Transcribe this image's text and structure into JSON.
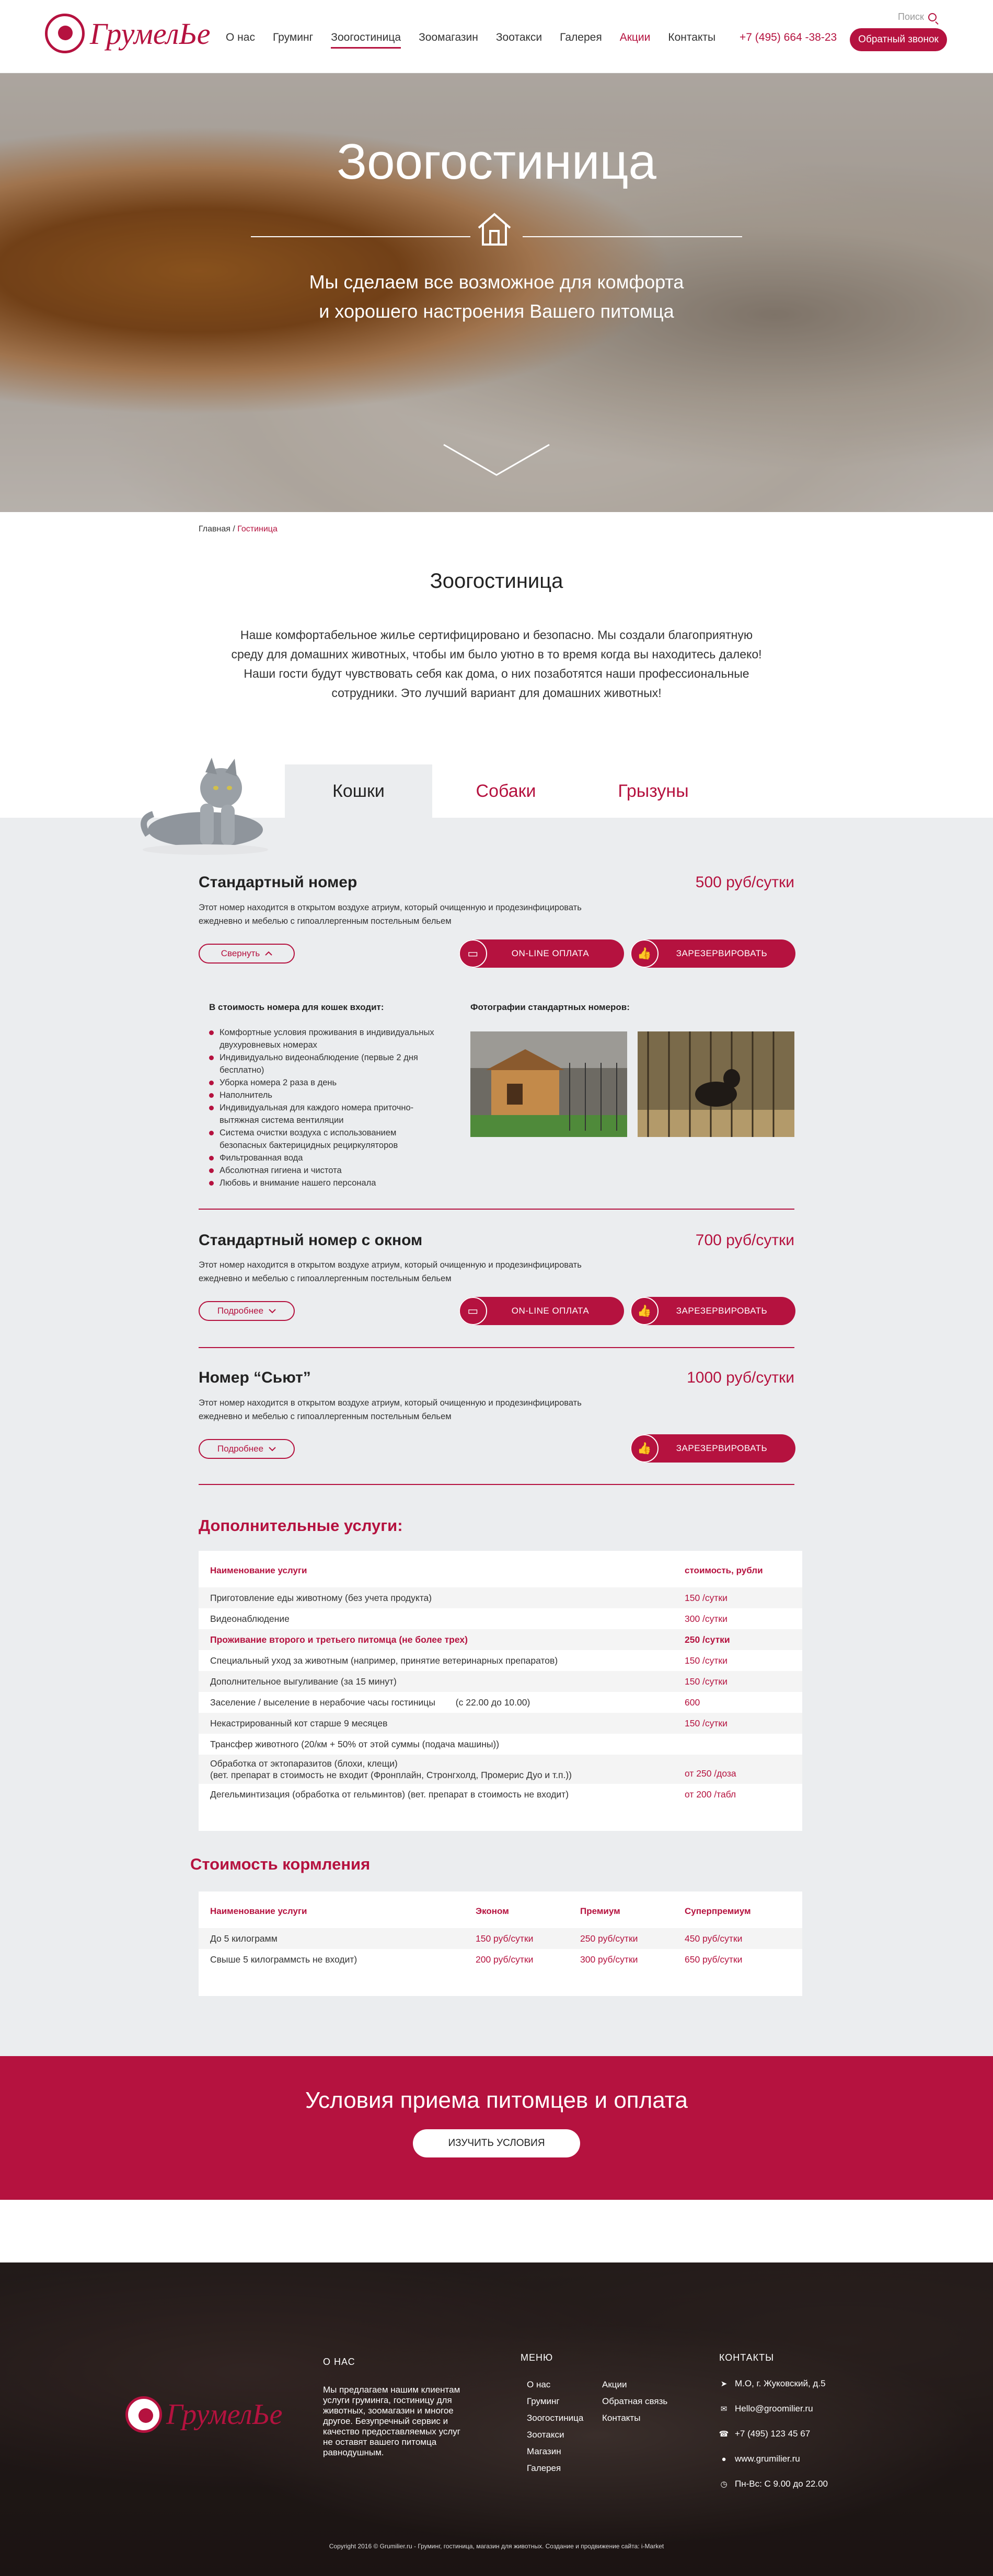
{
  "header": {
    "logo_text": "ГрумелЬе",
    "nav": [
      "О нас",
      "Груминг",
      "Зоогостиница",
      "Зоомагазин",
      "Зоотакси",
      "Галерея",
      "Акции",
      "Контакты"
    ],
    "phone": "+7 (495) 664 -38-23",
    "search_label": "Поиск",
    "callback_label": "Обратный звонок"
  },
  "hero": {
    "title": "Зоогостиница",
    "subtitle_line1": "Мы сделаем все возможное для комфорта",
    "subtitle_line2": "и хорошего настроения Вашего питомца"
  },
  "breadcrumb": {
    "home": "Главная",
    "sep": " / ",
    "current": "Гостиница"
  },
  "page_title": "Зоогостиница",
  "intro": "Наше комфортабельное жилье сертифицировано и безопасно. Мы создали благоприятную среду для домашних животных, чтобы им было уютно в то время когда вы находитесь далеко! Наши гости будут чувствовать себя как дома, о них позаботятся наши профессиональные сотрудники. Это лучший вариант для домашних животных!",
  "tabs": [
    "Кошки",
    "Собаки",
    "Грызуны"
  ],
  "rooms": [
    {
      "title": "Стандартный номер",
      "price": "500 руб/сутки",
      "desc": "Этот номер находится в открытом воздухе атриум, который очищенную и продезинфицировать ежедневно и мебелью с гипоаллергенным постельным бельем",
      "toggle": "Свернуть",
      "pay": "ON-LINE ОПЛАТА",
      "book": "ЗАРЕЗЕРВИРОВАТЬ"
    },
    {
      "title": "Стандартный номер с окном",
      "price": "700 руб/сутки",
      "desc": "Этот номер находится в открытом воздухе атриум, который очищенную и продезинфицировать ежедневно и мебелью с гипоаллергенным постельным бельем",
      "toggle": "Подробнее",
      "pay": "ON-LINE ОПЛАТА",
      "book": "ЗАРЕЗЕРВИРОВАТЬ"
    },
    {
      "title": "Номер “Сьют”",
      "price": "1000 руб/сутки",
      "desc": "Этот номер находится в открытом воздухе атриум, который очищенную и продезинфицировать ежедневно и мебелью с гипоаллергенным постельным бельем",
      "toggle": "Подробнее",
      "book": "ЗАРЕЗЕРВИРОВАТЬ"
    }
  ],
  "included": {
    "title": "В стоимость номера для кошек входит:",
    "items": [
      "Комфортные условия проживания в индивидуальных двухуровневых номерах",
      "Индивидуально видеонаблюдение (первые 2 дня бесплатно)",
      "Уборка номера 2 раза в день",
      "Наполнитель",
      "Индивидуальная для каждого номера приточно-вытяжная система вентиляции",
      "Система очистки воздуха с использованием безопасных бактерицидных рециркуляторов",
      "Фильтрованная вода",
      "Абсолютная гигиена и чистота",
      "Любовь и внимание нашего персонала"
    ],
    "photos_title": "Фотографии стандартных номеров:"
  },
  "extra": {
    "title": "Дополнительные услуги:",
    "head": {
      "name": "Наименование услуги",
      "price": "стоимость, рубли"
    },
    "rows": [
      {
        "name": "Приготовление еды животному (без учета продукта)",
        "price": "150 /сутки"
      },
      {
        "name": "Видеонаблюдение",
        "price": "300 /сутки"
      },
      {
        "name": "Проживание второго и третьего питомца (не более трех)",
        "price": "250 /сутки"
      },
      {
        "name": "Специальный уход за животным (например, принятие ветеринарных препаратов)",
        "price": "150 /сутки"
      },
      {
        "name": "Дополнительное выгуливание (за 15 минут)",
        "price": "150 /сутки"
      },
      {
        "name": "Заселение / выселение в нерабочие часы гостиницы        (с 22.00 до 10.00)",
        "price": "600"
      },
      {
        "name": "Некастрированный кот старше 9 месяцев",
        "price": "150 /сутки"
      },
      {
        "name": "Трансфер животного (20/км + 50% от этой суммы (подача машины))",
        "price": ""
      },
      {
        "name": "Обработка от эктопаразитов (блохи, клещи)",
        "name2": "(вет. препарат в стоимость не входит (Фронплайн, Стронгхолд, Промерис Дуо и т.п.))",
        "price": "от 250 /доза"
      },
      {
        "name": "Дегельминтизация (обработка от гельминтов) (вет. препарат в стоимость не входит)",
        "price": "от 200 /табл"
      }
    ]
  },
  "feeding": {
    "title": "Стоимость кормления",
    "head": [
      "Наименование услуги",
      "Эконом",
      "Премиум",
      "Суперпремиум"
    ],
    "rows": [
      [
        "До 5 килограмм",
        "150 руб/сутки",
        "250 руб/сутки",
        "450 руб/сутки"
      ],
      [
        "Свыше 5 килограммсть не входит)",
        "200 руб/сутки",
        "300 руб/сутки",
        "650 руб/сутки"
      ]
    ]
  },
  "banner": {
    "title": "Условия приема питомцев и оплата",
    "button": "ИЗУЧИТЬ УСЛОВИЯ"
  },
  "footer": {
    "about_title": "О НАС",
    "about_text": [
      "Мы предлагаем нашим клиентам",
      "услуги груминга, гостиницу для",
      "животных, зоомагазин и многое",
      "другое. Безупречный сервис и",
      "качество предоставляемых услуг",
      "не оставят вашего питомца",
      "равнодушным."
    ],
    "menu_title": "МЕНЮ",
    "menu_col1": [
      "О нас",
      "Груминг",
      "Зоогостиница",
      "Зоотакси",
      "Магазин",
      "Галерея"
    ],
    "menu_col2": [
      "Акции",
      "Обратная связь",
      "Контакты"
    ],
    "contacts_title": "КОНТАКТЫ",
    "contacts": [
      "М.О, г. Жуковский, д.5",
      "Hello@groomilier.ru",
      "+7 (495) 123 45 67",
      "www.grumilier.ru",
      "Пн-Вс: С 9.00 до 22.00"
    ],
    "copyright": "Copyright 2016 © Grumilier.ru - Груминг, гостиница, магазин для животных. Создание и продвижение сайта: i-Market"
  },
  "colors": {
    "accent": "#b5123f",
    "gray_bg": "#ebedef"
  }
}
